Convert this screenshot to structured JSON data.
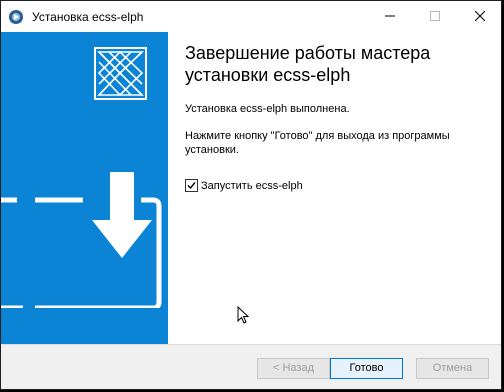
{
  "window": {
    "title": "Установка ecss-elph"
  },
  "content": {
    "heading": "Завершение работы мастера установки ecss-elph",
    "status_text": "Установка ecss-elph выполнена.",
    "instruction_text": "Нажмите кнопку \"Готово\" для выхода из программы установки.",
    "launch_checkbox_label": "Запустить ecss-elph",
    "launch_checkbox_checked": true
  },
  "buttons": {
    "back_label": "< Назад",
    "finish_label": "Готово",
    "cancel_label": "Отмена"
  },
  "colors": {
    "sidebar": "#0b84d6",
    "accent": "#0078d7"
  },
  "icons": {
    "app": "setup-app-icon",
    "minimize": "minimize-icon",
    "maximize": "maximize-icon",
    "close": "close-icon",
    "logo": "ecss-logo-icon",
    "sidebar_art": "laptop-download-icon",
    "cursor": "mouse-cursor-icon"
  }
}
